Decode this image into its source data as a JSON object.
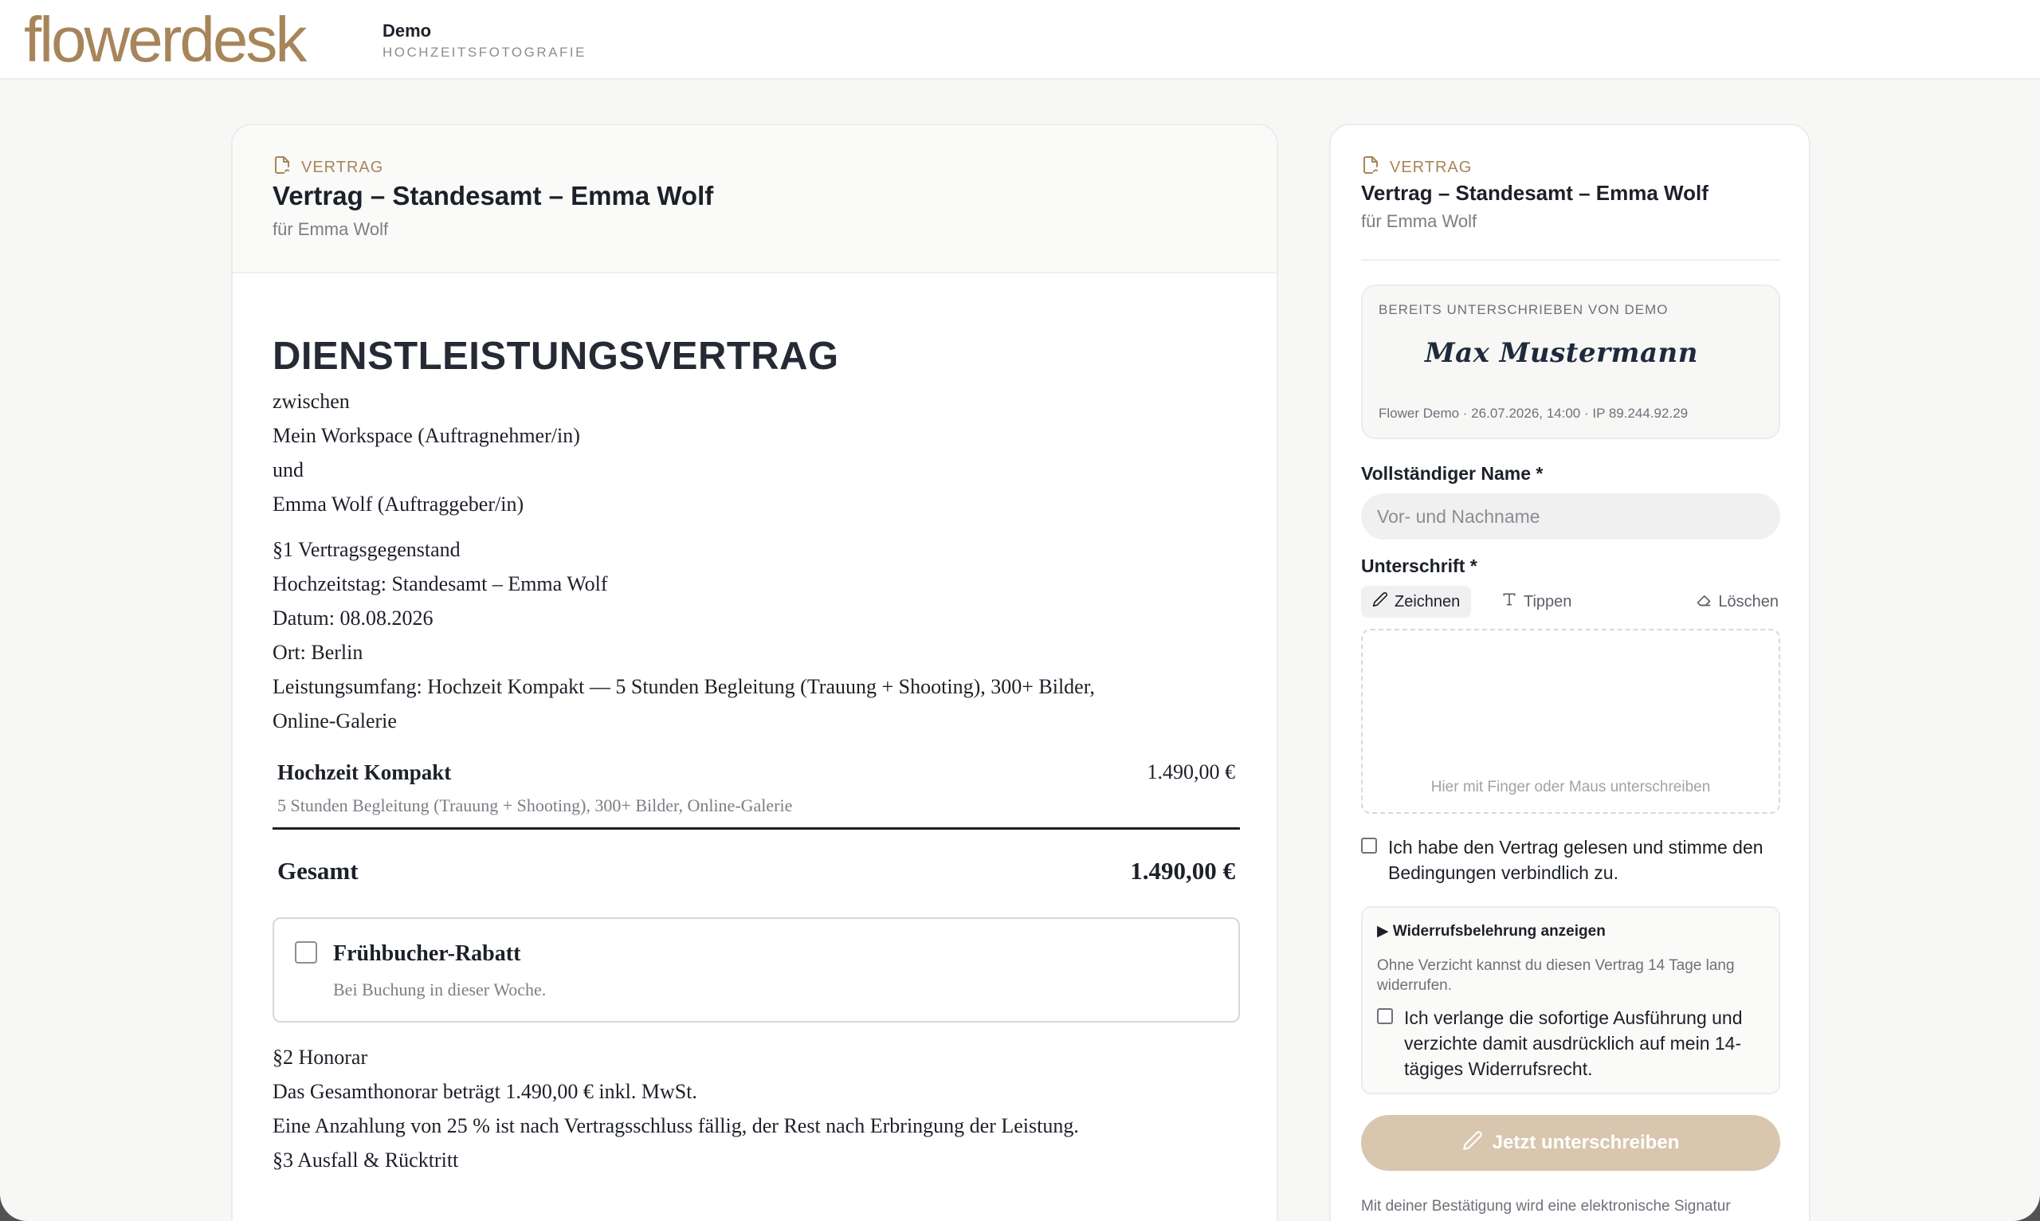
{
  "header": {
    "logo": "flowerdesk",
    "workspace_name": "Demo",
    "workspace_sub": "HOCHZEITSFOTOGRAFIE"
  },
  "document": {
    "kicker": "VERTRAG",
    "title": "Vertrag – Standesamt – Emma Wolf",
    "for": "für Emma Wolf",
    "heading": "DIENSTLEISTUNGSVERTRAG",
    "parties": [
      "zwischen",
      "Mein Workspace (Auftragnehmer/in)",
      "und",
      "Emma Wolf (Auftraggeber/in)"
    ],
    "section1": [
      "§1 Vertragsgegenstand",
      "Hochzeitstag: Standesamt – Emma Wolf",
      "Datum: 08.08.2026",
      "Ort: Berlin",
      "Leistungsumfang: Hochzeit Kompakt — 5 Stunden Begleitung (Trauung + Shooting), 300+ Bilder,",
      "Online-Galerie"
    ],
    "item": {
      "name": "Hochzeit Kompakt",
      "price": "1.490,00 €",
      "description": "5 Stunden Begleitung (Trauung + Shooting), 300+ Bilder, Online-Galerie"
    },
    "total": {
      "label": "Gesamt",
      "value": "1.490,00 €"
    },
    "option": {
      "title": "Frühbucher-Rabatt",
      "description": "Bei Buchung in dieser Woche.",
      "checked": false
    },
    "section2": [
      "§2 Honorar",
      "Das Gesamthonorar beträgt 1.490,00 € inkl. MwSt.",
      "Eine Anzahlung von 25 % ist nach Vertragsschluss fällig, der Rest nach Erbringung der Leistung.",
      "§3 Ausfall & Rücktritt"
    ]
  },
  "sign_panel": {
    "kicker": "VERTRAG",
    "title": "Vertrag – Standesamt – Emma Wolf",
    "for": "für Emma Wolf",
    "signed_label": "BEREITS UNTERSCHRIEBEN VON DEMO",
    "signed_signature": "Max Mustermann",
    "signed_meta": "Flower Demo · 26.07.2026, 14:00 · IP 89.244.92.29",
    "name_label": "Vollständiger Name *",
    "name_placeholder": "Vor- und Nachname",
    "name_value": "",
    "signature_label": "Unterschrift *",
    "tab_draw": "Zeichnen",
    "tab_type": "Tippen",
    "clear": "Löschen",
    "pad_hint": "Hier mit Finger oder Maus unterschreiben",
    "agree_text": "Ich habe den Vertrag gelesen und stimme den Bedingungen verbindlich zu.",
    "revocation_summary": "▶ Widerrufsbelehrung anzeigen",
    "revocation_info": "Ohne Verzicht kannst du diesen Vertrag 14 Tage lang widerrufen.",
    "revocation_waiver": "Ich verlange die sofortige Ausführung und verzichte damit ausdrücklich auf mein 14-tägiges Widerrufsrecht.",
    "sign_button": "Jetzt unterschreiben",
    "footer_note": "Mit deiner Bestätigung wird eine elektronische Signatur"
  },
  "colors": {
    "accent": "#a7855a",
    "button_disabled": "#d9c6ae",
    "text": "#1c2028",
    "muted": "#7b7e85"
  }
}
